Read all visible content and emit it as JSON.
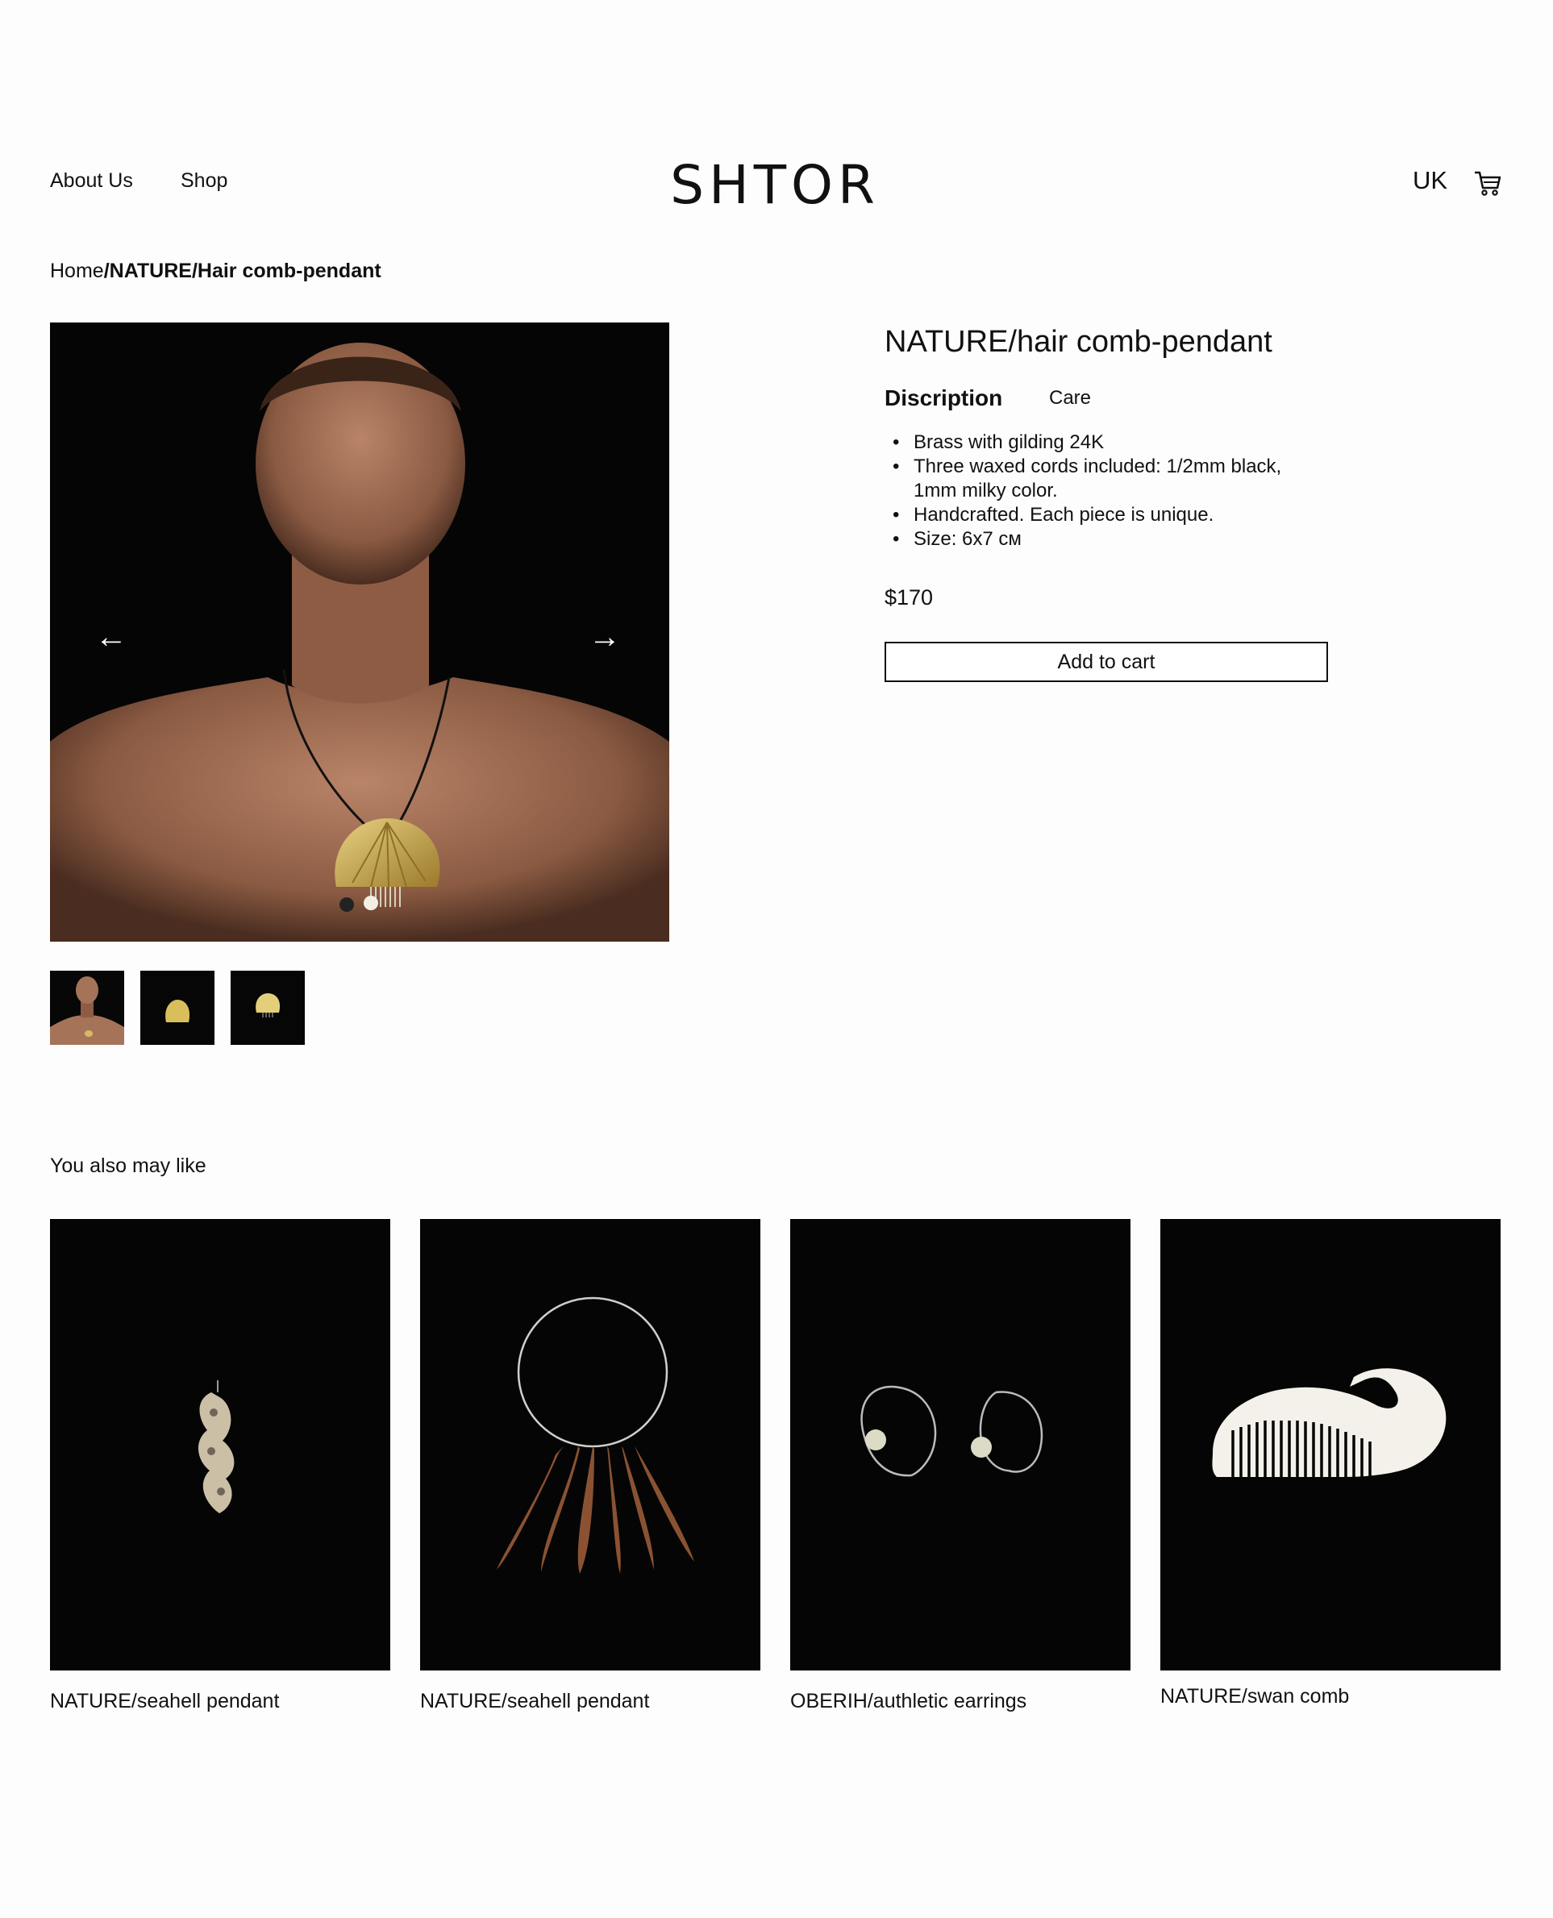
{
  "header": {
    "nav": [
      "About Us",
      "Shop"
    ],
    "logo": "SHTOR",
    "region": "UK",
    "cart_icon": "cart-icon"
  },
  "breadcrumb": {
    "home": "Home",
    "sep1": "/",
    "category": "NATURE",
    "sep2": "/",
    "current": "Hair comb-pendant"
  },
  "gallery": {
    "prev_icon": "arrow-left-icon",
    "next_icon": "arrow-right-icon",
    "prev": "←",
    "next": "→",
    "thumbnail_count": 3
  },
  "product": {
    "title": "NATURE/hair comb-pendant",
    "tabs": [
      "Discription",
      "Care"
    ],
    "active_tab": "Discription",
    "bullets": [
      "Brass with gilding 24K",
      "Three waxed cords included: 1/2mm black, 1mm milky color.",
      "Handcrafted. Each piece is unique.",
      "Size: 6x7 см"
    ],
    "price": "$170",
    "add_to_cart": "Add to cart"
  },
  "recommendations": {
    "heading": "You also may like",
    "items": [
      {
        "label": "NATURE/seahell pendant"
      },
      {
        "label": "NATURE/seahell pendant"
      },
      {
        "label": "OBERIH/authletic earrings"
      },
      {
        "label": "NATURE/swan comb"
      }
    ]
  },
  "colors": {
    "background": "#fdfdfd",
    "text": "#111111",
    "photo_bg": "#050505",
    "gold": "#c9a84a"
  }
}
